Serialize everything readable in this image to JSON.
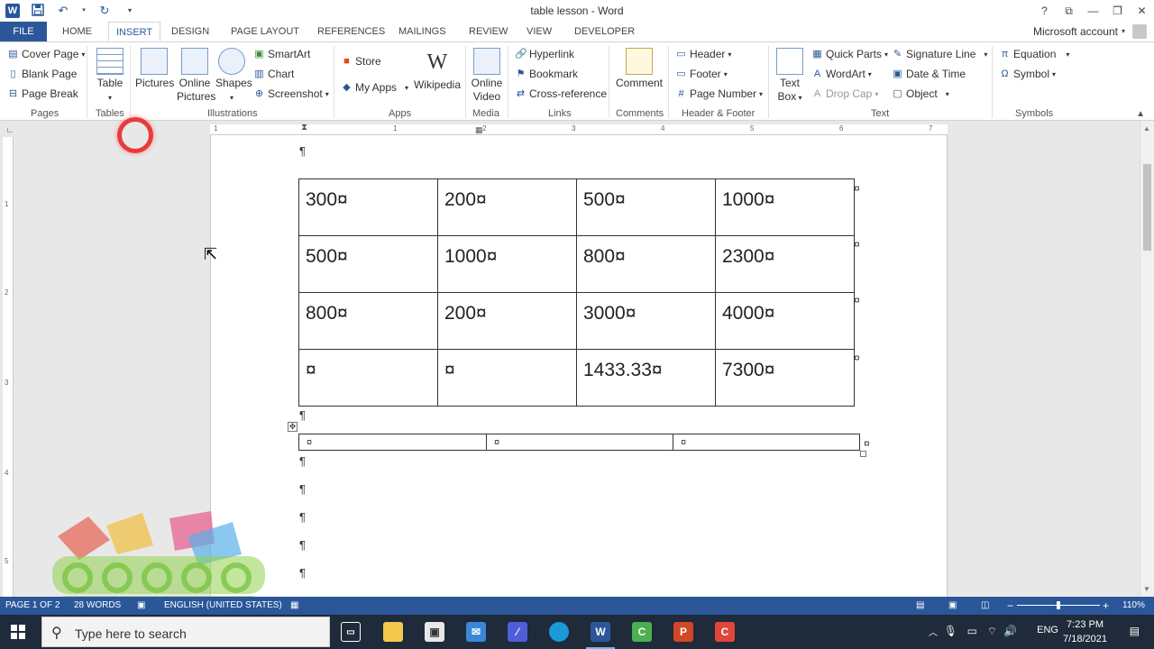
{
  "window": {
    "title": "table lesson - Word",
    "controls": [
      "?",
      "⧉",
      "—",
      "❐",
      "✕"
    ]
  },
  "quick_access": {
    "word_icon": "W",
    "save_icon": "save-icon",
    "undo_icon": "undo-icon",
    "redo_icon": "redo-icon",
    "customize_icon": "customize-qat-icon"
  },
  "tabs": {
    "file": "FILE",
    "items": [
      "HOME",
      "INSERT",
      "DESIGN",
      "PAGE LAYOUT",
      "REFERENCES",
      "MAILINGS",
      "REVIEW",
      "VIEW",
      "DEVELOPER"
    ],
    "active": "INSERT"
  },
  "account": {
    "label": "Microsoft account"
  },
  "ribbon": {
    "pages": {
      "group": "Pages",
      "cover_page": "Cover Page",
      "blank_page": "Blank Page",
      "page_break": "Page Break"
    },
    "tables": {
      "group": "Tables",
      "table": "Table"
    },
    "illustrations": {
      "group": "Illustrations",
      "pictures": "Pictures",
      "online_pictures_1": "Online",
      "online_pictures_2": "Pictures",
      "shapes": "Shapes",
      "smartart": "SmartArt",
      "chart": "Chart",
      "screenshot": "Screenshot"
    },
    "apps": {
      "group": "Apps",
      "store": "Store",
      "my_apps": "My Apps",
      "wikipedia": "Wikipedia",
      "wikipedia_glyph": "W"
    },
    "media": {
      "group": "Media",
      "online_video_1": "Online",
      "online_video_2": "Video"
    },
    "links": {
      "group": "Links",
      "hyperlink": "Hyperlink",
      "bookmark": "Bookmark",
      "cross_reference": "Cross-reference"
    },
    "comments": {
      "group": "Comments",
      "comment": "Comment"
    },
    "header_footer": {
      "group": "Header & Footer",
      "header": "Header",
      "footer": "Footer",
      "page_number": "Page Number"
    },
    "text": {
      "group": "Text",
      "text_box_1": "Text",
      "text_box_2": "Box",
      "quick_parts": "Quick Parts",
      "wordart": "WordArt",
      "drop_cap": "Drop Cap",
      "signature_line": "Signature Line",
      "date_time": "Date & Time",
      "object": "Object"
    },
    "symbols": {
      "group": "Symbols",
      "equation": "Equation",
      "symbol": "Symbol",
      "equation_glyph": "π",
      "symbol_glyph": "Ω"
    }
  },
  "ruler": {
    "h_numbers": [
      "1",
      "1",
      "2",
      "3",
      "4",
      "5",
      "6",
      "7"
    ],
    "v_numbers": [
      "1",
      "2",
      "3",
      "4",
      "5"
    ]
  },
  "document": {
    "pilcrow": "¶",
    "table1": [
      [
        "300¤",
        "200¤",
        "500¤",
        "1000¤"
      ],
      [
        "500¤",
        "1000¤",
        "800¤",
        "2300¤"
      ],
      [
        "800¤",
        "200¤",
        "3000¤",
        "4000¤"
      ],
      [
        "¤",
        "¤",
        "1433.33¤",
        "7300¤"
      ]
    ],
    "row_end_mark": "¤",
    "table2": [
      "¤",
      "¤",
      "¤"
    ],
    "move_handle": "✥"
  },
  "statusbar": {
    "page": "PAGE 1 OF 2",
    "words": "28 WORDS",
    "language": "ENGLISH (UNITED STATES)",
    "zoom": "110%",
    "zoom_minus": "−",
    "zoom_plus": "+"
  },
  "taskbar": {
    "search_placeholder": "Type here to search",
    "apps": [
      "task-view-icon",
      "file-explorer-icon",
      "store-icon",
      "mail-icon",
      "visual-studio-icon",
      "edge-icon",
      "word-icon",
      "camtasia-icon",
      "powerpoint-icon",
      "camtasia-recorder-icon"
    ],
    "lang": "ENG",
    "time": "7:23 PM",
    "date": "7/18/2021"
  },
  "colors": {
    "word_blue": "#2b579a",
    "taskbar": "#1f2a3a",
    "click_highlight": "#e83c3c"
  }
}
